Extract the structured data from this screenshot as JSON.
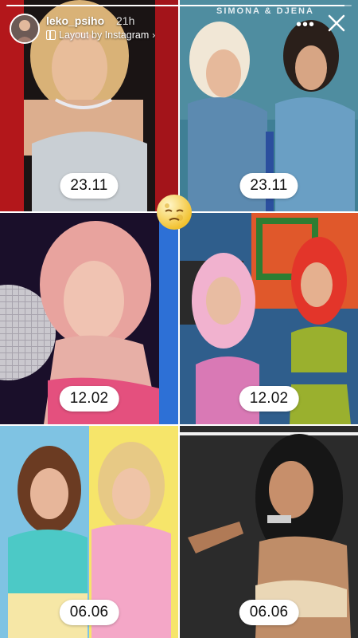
{
  "story": {
    "username": "leko_psiho",
    "time": "21h",
    "layout_label": "Layout by Instagram",
    "progress": 0.98
  },
  "watermark": "SIMONA & DJENA",
  "cells": [
    {
      "date": "23.11"
    },
    {
      "date": "23.11"
    },
    {
      "date": "12.02"
    },
    {
      "date": "12.02"
    },
    {
      "date": "06.06"
    },
    {
      "date": "06.06"
    }
  ],
  "sticker": {
    "icon": "moon-face-emoji"
  },
  "colors": {
    "pill_bg": "#ffffff",
    "pill_text": "#111111",
    "text_light": "#ffffff"
  }
}
